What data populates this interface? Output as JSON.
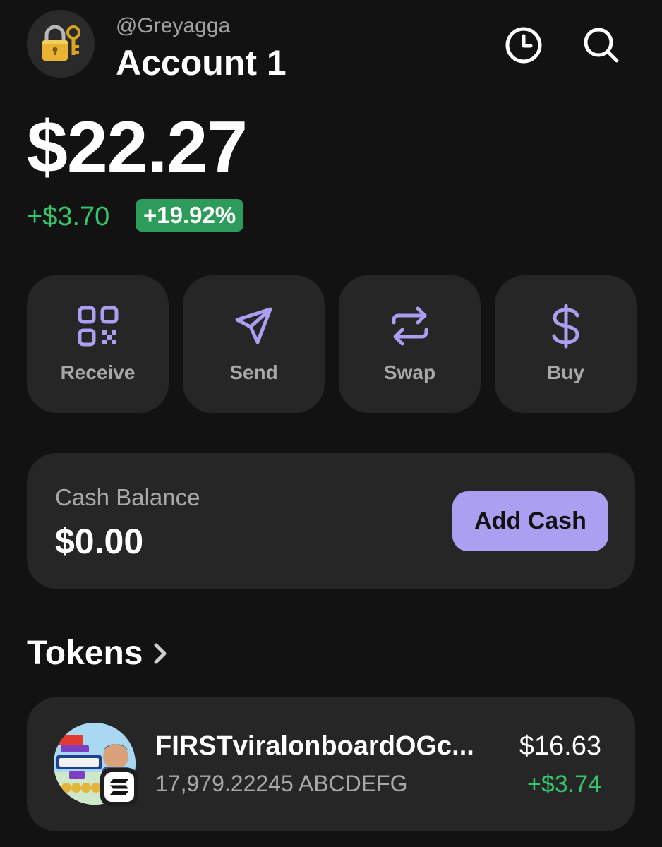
{
  "header": {
    "handle": "@Greyagga",
    "account_name": "Account 1",
    "avatar_icon": "locked-with-key-icon",
    "history_icon": "clock-icon",
    "search_icon": "search-icon"
  },
  "portfolio": {
    "balance": "$22.27",
    "change_amount": "+$3.70",
    "change_percent": "+19.92%"
  },
  "actions": [
    {
      "label": "Receive",
      "icon": "qr-code-icon"
    },
    {
      "label": "Send",
      "icon": "send-icon"
    },
    {
      "label": "Swap",
      "icon": "swap-icon"
    },
    {
      "label": "Buy",
      "icon": "dollar-icon"
    }
  ],
  "cash": {
    "label": "Cash Balance",
    "value": "$0.00",
    "button_label": "Add Cash"
  },
  "tokens": {
    "heading": "Tokens",
    "items": [
      {
        "name": "FIRSTviralonboardOGc...",
        "amount": "17,979.22245 ABCDEFG",
        "value": "$16.63",
        "change": "+$3.74",
        "chain_icon": "solana-icon"
      }
    ]
  },
  "colors": {
    "background": "#121212",
    "card": "#262626",
    "accent": "#ab9ff2",
    "positive": "#35c46a",
    "positive_badge": "#2d9b5a"
  }
}
